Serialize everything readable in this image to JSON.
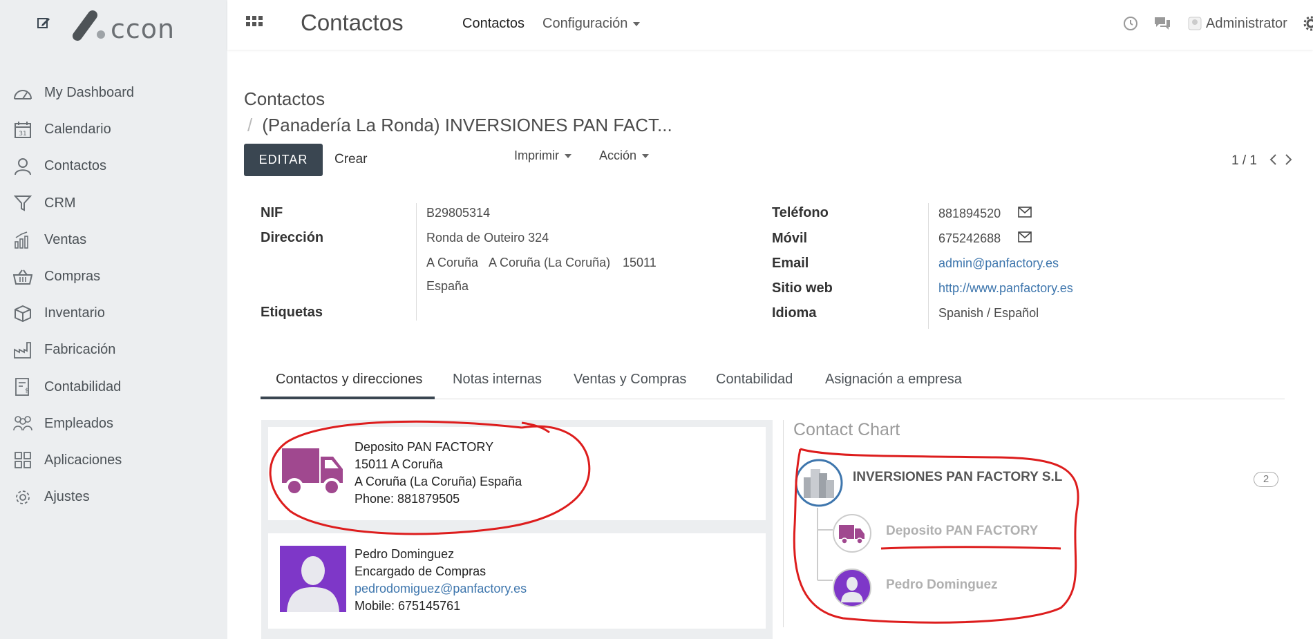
{
  "sidebar": {
    "logo_text": "ccon",
    "items": [
      {
        "label": "My Dashboard",
        "icon": "dashboard-icon"
      },
      {
        "label": "Calendario",
        "icon": "calendar-icon",
        "icon_text": "31"
      },
      {
        "label": "Contactos",
        "icon": "user-icon"
      },
      {
        "label": "CRM",
        "icon": "funnel-icon"
      },
      {
        "label": "Ventas",
        "icon": "sales-chart-icon"
      },
      {
        "label": "Compras",
        "icon": "basket-icon"
      },
      {
        "label": "Inventario",
        "icon": "box-icon"
      },
      {
        "label": "Fabricación",
        "icon": "factory-icon"
      },
      {
        "label": "Contabilidad",
        "icon": "accounting-icon"
      },
      {
        "label": "Empleados",
        "icon": "employees-icon"
      },
      {
        "label": "Aplicaciones",
        "icon": "apps-grid-icon"
      },
      {
        "label": "Ajustes",
        "icon": "gear-icon"
      }
    ]
  },
  "topbar": {
    "app_title": "Contactos",
    "nav_contactos": "Contactos",
    "nav_config": "Configuración",
    "user": "Administrator"
  },
  "control": {
    "breadcrumb_parent": "Contactos",
    "breadcrumb_sep": "/",
    "breadcrumb_current": "(Panadería La Ronda) INVERSIONES PAN FACT...",
    "edit_label": "EDITAR",
    "create_label": "Crear",
    "print_label": "Imprimir",
    "action_label": "Acción",
    "pager": "1 / 1"
  },
  "form": {
    "left": {
      "nif_label": "NIF",
      "nif": "B29805314",
      "address_label": "Dirección",
      "street": "Ronda de Outeiro 324",
      "city": "A Coruña",
      "state": "A Coruña (La Coruña)",
      "zip": "15011",
      "country": "España",
      "tags_label": "Etiquetas"
    },
    "right": {
      "phone_label": "Teléfono",
      "phone": "881894520",
      "mobile_label": "Móvil",
      "mobile": "675242688",
      "email_label": "Email",
      "email": "admin@panfactory.es",
      "website_label": "Sitio web",
      "website": "http://www.panfactory.es",
      "language_label": "Idioma",
      "language": "Spanish / Español"
    }
  },
  "tabs": [
    {
      "label": "Contactos y direcciones",
      "active": true
    },
    {
      "label": "Notas internas"
    },
    {
      "label": "Ventas y Compras"
    },
    {
      "label": "Contabilidad"
    },
    {
      "label": "Asignación a empresa"
    }
  ],
  "contacts": [
    {
      "name": "Deposito PAN FACTORY",
      "line2": "15011 A Coruña",
      "line3": "A Coruña (La Coruña) España",
      "line4": "Phone: 881879505",
      "icon": "delivery-truck-icon"
    },
    {
      "name": "Pedro Dominguez",
      "line2": "Encargado de Compras",
      "line3": "pedrodomiguez@panfactory.es",
      "line4": "Mobile: 675145761",
      "icon": "person-avatar"
    }
  ],
  "contact_chart": {
    "title": "Contact Chart",
    "company": "INVERSIONES PAN FACTORY S.L",
    "count": "2",
    "children": [
      "Deposito PAN FACTORY",
      "Pedro Dominguez"
    ]
  },
  "colors": {
    "accent": "#3a4651",
    "link": "#3e76ad",
    "truck": "#a0488f",
    "avatar_bg": "#7e37c8",
    "annotation": "#dd1d1d"
  }
}
